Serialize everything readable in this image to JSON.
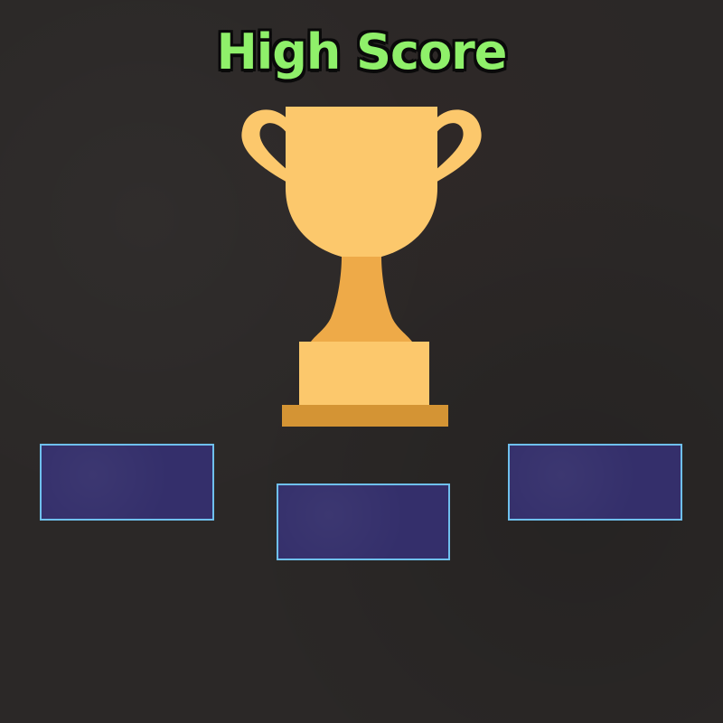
{
  "screen": {
    "title": "High Score",
    "title_color": "#8ff06a",
    "background_color": "#2b2827"
  },
  "trophy": {
    "icon": "trophy-icon",
    "cup_color": "#fcc86c",
    "stem_color": "#eeaa48",
    "base_plate_color": "#d49434"
  },
  "score_slots": [
    {
      "position": "left",
      "value": ""
    },
    {
      "position": "center",
      "value": ""
    },
    {
      "position": "right",
      "value": ""
    }
  ],
  "slot_style": {
    "fill_color": "#342f6b",
    "border_color": "#6fc0ee"
  }
}
